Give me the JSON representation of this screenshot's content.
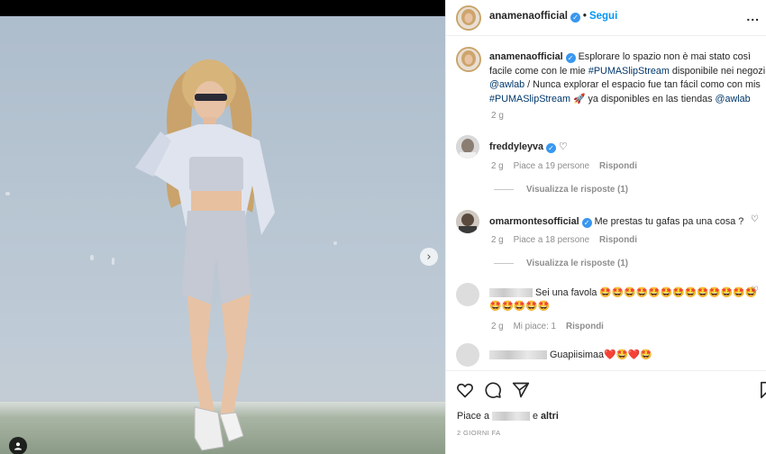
{
  "post": {
    "username": "anamenaofficial",
    "follow_label": "Segui",
    "more_label": "...",
    "caption_username": "anamenaofficial",
    "caption_part1": "Esplorare lo spazio non è mai stato così facile come con le mie ",
    "hashtag1": "#PUMASlipStream",
    "caption_part2": " disponibile nei negozi ",
    "mention1": "@awlab",
    "caption_part3": " / Nunca explorar el espacio fue tan fácil como con mis ",
    "hashtag2": "#PUMASlipStream",
    "caption_part4": " 🚀 ya disponibles en las tiendas ",
    "mention2": "@awlab",
    "caption_time": "2 g"
  },
  "comments": [
    {
      "username": "freddyleyva",
      "text": "♡",
      "time": "2 g",
      "likes": "Piace a 19 persone",
      "reply": "Rispondi",
      "view_replies": "Visualizza le risposte (1)"
    },
    {
      "username": "omarmontesofficial",
      "text": "Me prestas tu gafas pa una cosa ?",
      "time": "2 g",
      "likes": "Piace a 18 persone",
      "reply": "Rispondi",
      "view_replies": "Visualizza le risposte (1)"
    },
    {
      "username": "",
      "text": "Sei una favola 🤩🤩🤩🤩🤩🤩🤩🤩🤩🤩🤩🤩🤩🤩🤩🤩🤩🤩",
      "time": "2 g",
      "likes": "Mi piace: 1",
      "reply": "Rispondi"
    },
    {
      "username": "",
      "text": "Guapiisimaa❤️🤩❤️🤩"
    }
  ],
  "footer": {
    "likes_prefix": "Piace a",
    "likes_suffix": "e",
    "likes_others": "altri",
    "date": "2 GIORNI FA"
  },
  "icons": {
    "verified": "verified-badge-icon",
    "like": "heart-icon",
    "comment": "comment-icon",
    "share": "paper-plane-icon",
    "save": "bookmark-icon",
    "next": "chevron-right-icon",
    "user_tag": "user-tag-icon"
  },
  "colors": {
    "link": "#0095f6",
    "hashtag": "#00376b",
    "verified": "#3897f0",
    "muted": "#8e8e8e"
  }
}
